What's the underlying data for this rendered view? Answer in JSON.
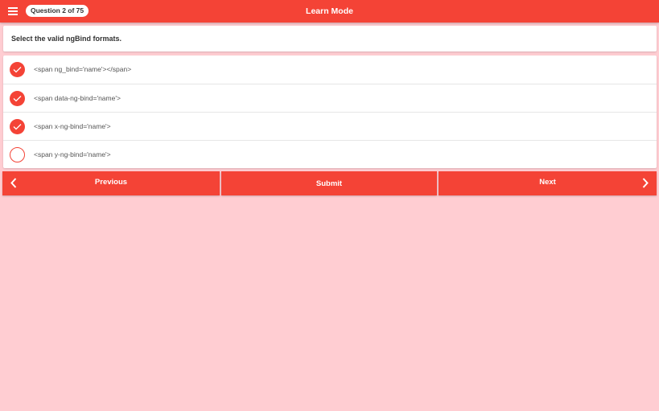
{
  "header": {
    "question_badge": "Question 2 of 75",
    "title": "Learn Mode",
    "menu_icon": "hamburger-menu-icon"
  },
  "question": {
    "text": "Select the valid ngBind formats."
  },
  "options": [
    {
      "label": "<span ng_bind='name'></span>",
      "checked": true
    },
    {
      "label": "<span data-ng-bind='name'>",
      "checked": true
    },
    {
      "label": "<span x-ng-bind='name'>",
      "checked": true
    },
    {
      "label": "<span y-ng-bind='name'>",
      "checked": false
    }
  ],
  "navigation": {
    "previous_label": "Previous",
    "submit_label": "Submit",
    "next_label": "Next"
  },
  "colors": {
    "accent": "#f44336",
    "background": "#ffcdd2"
  }
}
